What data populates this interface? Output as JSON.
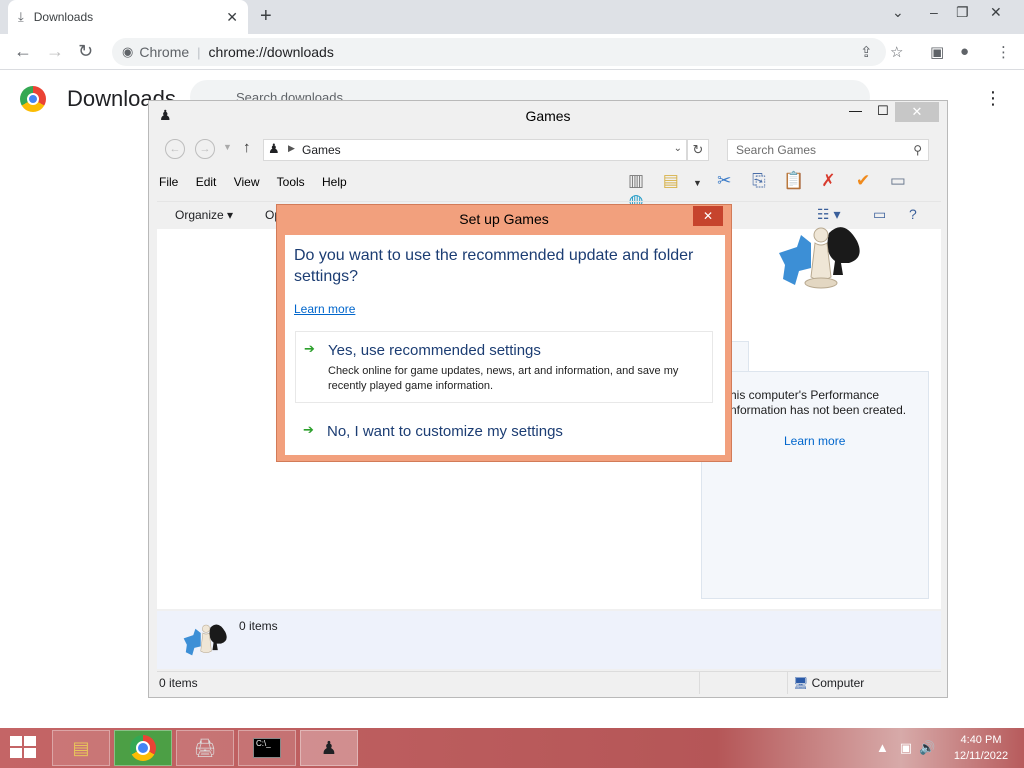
{
  "chrome": {
    "tab_title": "Downloads",
    "omnibox_site": "Chrome",
    "omnibox_url": "chrome://downloads",
    "page_title": "Downloads",
    "search_placeholder": "Search downloads"
  },
  "games_window": {
    "title": "Games",
    "address": "Games",
    "search_placeholder": "Search Games",
    "menu": [
      "File",
      "Edit",
      "View",
      "Tools",
      "Help"
    ],
    "organize_label": "Organize",
    "open_partial": "Op",
    "perf_text": "his computer's Performance\nnformation has not been created.",
    "learn_more_side": "Learn more",
    "details_count": "0 items",
    "status_items": "0 items",
    "status_location": "Computer"
  },
  "setup_dialog": {
    "title": "Set up Games",
    "question": "Do you want to use the recommended update and folder settings?",
    "learn_more": "Learn more",
    "option1_title": "Yes, use recommended settings",
    "option1_desc": "Check online for game updates, news, art and information, and save my recently played game information.",
    "option2_title": "No, I want to customize my settings"
  },
  "taskbar": {
    "time": "4:40 PM",
    "date": "12/11/2022"
  },
  "colors": {
    "dialog_frame": "#f2a07d",
    "taskbar": "#c46566",
    "link": "#0066cc"
  }
}
